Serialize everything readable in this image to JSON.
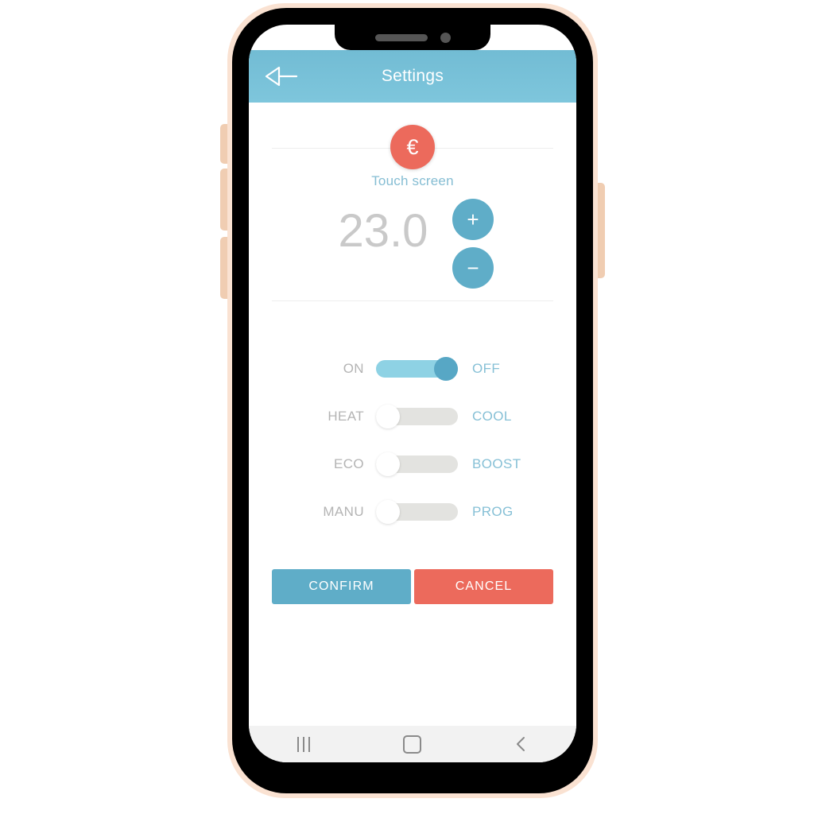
{
  "device": {
    "notch": {
      "speaker_name": "earpiece-speaker",
      "camera_name": "front-camera"
    },
    "side_buttons": [
      "silent-switch",
      "volume-up-button",
      "volume-down-button",
      "power-button"
    ]
  },
  "header": {
    "title": "Settings",
    "back_icon": "back-arrow-icon"
  },
  "device_card": {
    "badge_symbol": "€",
    "badge_icon_name": "euro-badge-icon",
    "mode_label": "Touch screen"
  },
  "temperature": {
    "value": "23.0",
    "increase_label": "+",
    "decrease_label": "−"
  },
  "toggles": [
    {
      "left_label": "ON",
      "right_label": "OFF",
      "state": "on",
      "name": "toggle-on-off"
    },
    {
      "left_label": "HEAT",
      "right_label": "COOL",
      "state": "off",
      "name": "toggle-heat-cool"
    },
    {
      "left_label": "ECO",
      "right_label": "BOOST",
      "state": "off",
      "name": "toggle-eco-boost"
    },
    {
      "left_label": "MANU",
      "right_label": "PROG",
      "state": "off",
      "name": "toggle-manu-prog"
    }
  ],
  "actions": {
    "confirm_label": "CONFIRM",
    "cancel_label": "CANCEL"
  },
  "nav_bar": {
    "recents_name": "recents-button",
    "home_name": "home-button",
    "back_name": "back-button",
    "back_glyph": "‹"
  },
  "colors": {
    "header_blue": "#7ec6dc",
    "accent_blue": "#5fadc8",
    "light_blue": "#8ed2e4",
    "label_blue": "#86c0d6",
    "coral": "#ec6a5c",
    "gray_label": "#b4b4b4",
    "value_gray": "#c9c9c9",
    "track_gray": "#e3e3e0",
    "rim_peach": "#fae2d2"
  }
}
